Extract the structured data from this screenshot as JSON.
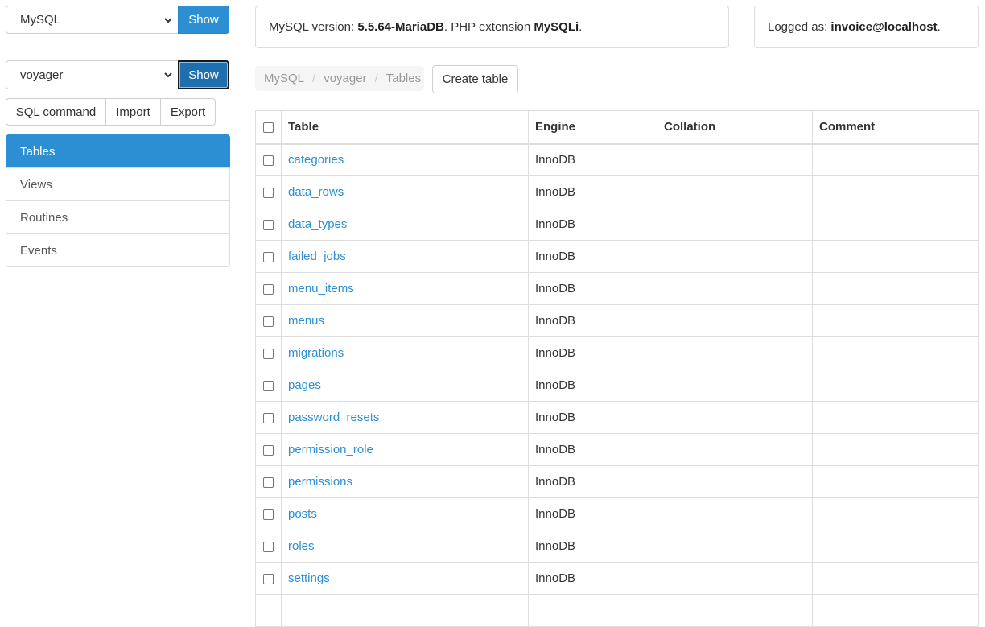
{
  "server_select": {
    "value": "MySQL",
    "button": "Show"
  },
  "database_select": {
    "value": "voyager",
    "button": "Show"
  },
  "actions": [
    "SQL command",
    "Import",
    "Export"
  ],
  "nav": [
    {
      "label": "Tables",
      "active": true
    },
    {
      "label": "Views",
      "active": false
    },
    {
      "label": "Routines",
      "active": false
    },
    {
      "label": "Events",
      "active": false
    }
  ],
  "version_info": {
    "prefix": "MySQL version: ",
    "version": "5.5.64-MariaDB",
    "middle": ". PHP extension ",
    "extension": "MySQLi",
    "suffix": "."
  },
  "login_info": {
    "prefix": "Logged as: ",
    "user": "invoice@localhost",
    "suffix": "."
  },
  "breadcrumb": [
    "MySQL",
    "voyager",
    "Tables"
  ],
  "create_table_button": "Create table",
  "table": {
    "columns": [
      "Table",
      "Engine",
      "Collation",
      "Comment"
    ],
    "rows": [
      {
        "name": "categories",
        "engine": "InnoDB",
        "collation": "",
        "comment": ""
      },
      {
        "name": "data_rows",
        "engine": "InnoDB",
        "collation": "",
        "comment": ""
      },
      {
        "name": "data_types",
        "engine": "InnoDB",
        "collation": "",
        "comment": ""
      },
      {
        "name": "failed_jobs",
        "engine": "InnoDB",
        "collation": "",
        "comment": ""
      },
      {
        "name": "menu_items",
        "engine": "InnoDB",
        "collation": "",
        "comment": ""
      },
      {
        "name": "menus",
        "engine": "InnoDB",
        "collation": "",
        "comment": ""
      },
      {
        "name": "migrations",
        "engine": "InnoDB",
        "collation": "",
        "comment": ""
      },
      {
        "name": "pages",
        "engine": "InnoDB",
        "collation": "",
        "comment": ""
      },
      {
        "name": "password_resets",
        "engine": "InnoDB",
        "collation": "",
        "comment": ""
      },
      {
        "name": "permission_role",
        "engine": "InnoDB",
        "collation": "",
        "comment": ""
      },
      {
        "name": "permissions",
        "engine": "InnoDB",
        "collation": "",
        "comment": ""
      },
      {
        "name": "posts",
        "engine": "InnoDB",
        "collation": "",
        "comment": ""
      },
      {
        "name": "roles",
        "engine": "InnoDB",
        "collation": "",
        "comment": ""
      },
      {
        "name": "settings",
        "engine": "InnoDB",
        "collation": "",
        "comment": ""
      },
      {
        "name": "",
        "engine": "",
        "collation": "",
        "comment": ""
      }
    ]
  },
  "colors": {
    "accent": "#2c8fd3",
    "border": "#dddddd",
    "muted": "#999999"
  }
}
